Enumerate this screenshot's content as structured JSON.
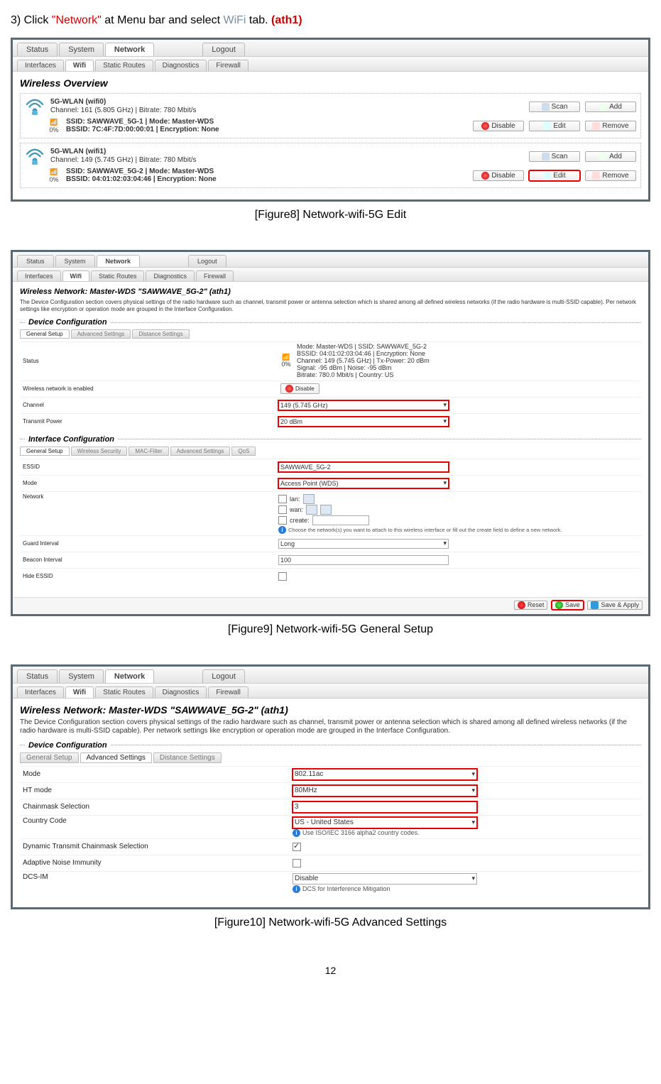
{
  "instruction": {
    "prefix": "3) Click ",
    "network_quote": "\"Network\"",
    "mid": " at Menu bar and select ",
    "wifi": "WiFi",
    "tab_word": " tab. ",
    "ath": "(ath1)"
  },
  "page_number": "12",
  "captions": {
    "fig8": "[Figure8] Network-wifi-5G Edit",
    "fig9": "[Figure9] Network-wifi-5G General Setup",
    "fig10": "[Figure10] Network-wifi-5G Advanced Settings"
  },
  "tabs_main": [
    "Status",
    "System",
    "Network",
    "Logout"
  ],
  "tabs_sub": [
    "Interfaces",
    "Wifi",
    "Static Routes",
    "Diagnostics",
    "Firewall"
  ],
  "fig8": {
    "title": "Wireless Overview",
    "cards": [
      {
        "head": "5G-WLAN (wifi0)",
        "chan": "Channel: 161 (5.805 GHz) | Bitrate: 780 Mbit/s",
        "ssid": "SSID: SAWWAVE_5G-1 | Mode: Master-WDS",
        "bssid": "BSSID: 7C:4F:7D:00:00:01 | Encryption: None",
        "sig": "0%"
      },
      {
        "head": "5G-WLAN (wifi1)",
        "chan": "Channel: 149 (5.745 GHz) | Bitrate: 780 Mbit/s",
        "ssid": "SSID: SAWWAVE_5G-2 | Mode: Master-WDS",
        "bssid": "BSSID: 04:01:02:03:04:46 | Encryption: None",
        "sig": "0%"
      }
    ],
    "btns": {
      "scan": "Scan",
      "add": "Add",
      "disable": "Disable",
      "edit": "Edit",
      "remove": "Remove"
    }
  },
  "fig9": {
    "title": "Wireless Network: Master-WDS \"SAWWAVE_5G-2\" (ath1)",
    "desc": "The Device Configuration section covers physical settings of the radio hardware such as channel, transmit power or antenna selection which is shared among all defined wireless networks (if the radio hardware is multi-SSID capable). Per network settings like encryption or operation mode are grouped in the Interface Configuration.",
    "section1": "Device Configuration",
    "tabs1": [
      "General Setup",
      "Advanced Settings",
      "Distance Settings"
    ],
    "status_label": "Status",
    "status_lines": "Mode: Master-WDS | SSID: SAWWAVE_5G-2\nBSSID: 04:01:02:03:04:46 | Encryption: None\nChannel: 149 (5.745 GHz) | Tx-Power: 20 dBm\nSignal: -95 dBm | Noise: -95 dBm\nBitrate: 780.0 Mbit/s | Country: US",
    "sig": "0%",
    "enabled_label": "Wireless network is enabled",
    "disable_btn": "Disable",
    "channel_label": "Channel",
    "channel_val": "149 (5.745 GHz)",
    "tx_label": "Transmit Power",
    "tx_val": "20 dBm",
    "section2": "Interface Configuration",
    "tabs2": [
      "General Setup",
      "Wireless Security",
      "MAC-Filter",
      "Advanced Settings",
      "QoS"
    ],
    "essid_label": "ESSID",
    "essid_val": "SAWWAVE_5G-2",
    "mode_label": "Mode",
    "mode_val": "Access Point (WDS)",
    "network_label": "Network",
    "net_lan": "lan:",
    "net_wan": "wan:",
    "net_create": "create:",
    "net_hint": "Choose the network(s) you want to attach to this wireless interface or fill out the create field to define a new network.",
    "gi_label": "Guard Interval",
    "gi_val": "Long",
    "bi_label": "Beacon Interval",
    "bi_val": "100",
    "hide_label": "Hide ESSID",
    "reset": "Reset",
    "save": "Save",
    "apply": "Save & Apply"
  },
  "fig10": {
    "title": "Wireless Network: Master-WDS \"SAWWAVE_5G-2\" (ath1)",
    "desc": "The Device Configuration section covers physical settings of the radio hardware such as channel, transmit power or antenna selection which is shared among all defined wireless networks (if the radio hardware is multi-SSID capable). Per network settings like encryption or operation mode are grouped in the Interface Configuration.",
    "section": "Device Configuration",
    "tabs": [
      "General Setup",
      "Advanced Settings",
      "Distance Settings"
    ],
    "mode_label": "Mode",
    "mode_val": "802.11ac",
    "ht_label": "HT mode",
    "ht_val": "80MHz",
    "chain_label": "Chainmask Selection",
    "chain_val": "3",
    "cc_label": "Country Code",
    "cc_val": "US - United States",
    "cc_hint": "Use ISO/IEC 3166 alpha2 country codes.",
    "dtcs_label": "Dynamic Transmit Chainmask Selection",
    "ani_label": "Adaptive Noise Immunity",
    "dcs_label": "DCS-IM",
    "dcs_val": "Disable",
    "dcs_hint": "DCS for Interference Mitigation"
  }
}
